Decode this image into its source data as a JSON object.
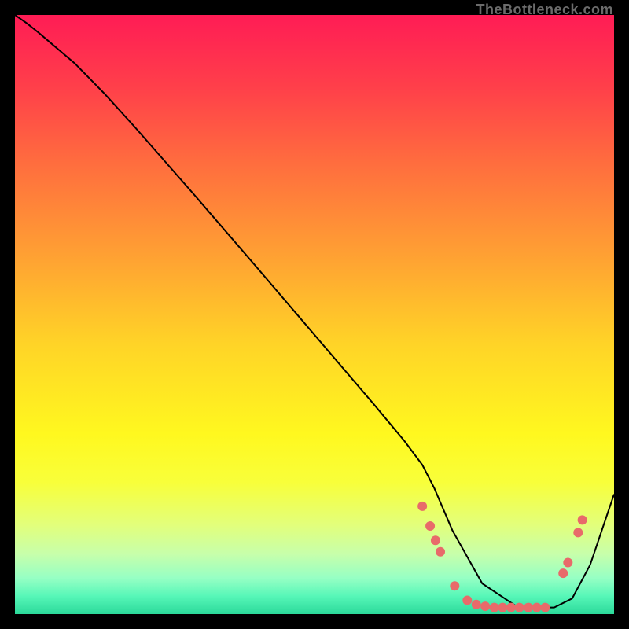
{
  "watermark": "TheBottleneck.com",
  "chart_data": {
    "type": "line",
    "title": "",
    "xlabel": "",
    "ylabel": "",
    "xlim": [
      0,
      100
    ],
    "ylim": [
      0,
      100
    ],
    "background_gradient": {
      "stops": [
        {
          "pct": 0,
          "color": "#ff1c55"
        },
        {
          "pct": 12,
          "color": "#ff3f4a"
        },
        {
          "pct": 25,
          "color": "#ff6e3e"
        },
        {
          "pct": 40,
          "color": "#ffa033"
        },
        {
          "pct": 55,
          "color": "#ffd427"
        },
        {
          "pct": 70,
          "color": "#fff81f"
        },
        {
          "pct": 78,
          "color": "#f8ff3a"
        },
        {
          "pct": 85,
          "color": "#e3ff7a"
        },
        {
          "pct": 90,
          "color": "#c7ffab"
        },
        {
          "pct": 94,
          "color": "#96ffc4"
        },
        {
          "pct": 97,
          "color": "#57f7b8"
        },
        {
          "pct": 100,
          "color": "#2bd99a"
        }
      ]
    },
    "series": [
      {
        "name": "curve",
        "stroke": "#000000",
        "stroke_width": 2,
        "x": [
          0.0,
          2.0,
          4.0,
          6.0,
          8.0,
          10.0,
          15.0,
          20.0,
          30.0,
          40.0,
          50.0,
          60.0,
          65.0,
          68.0,
          70.0,
          73.0,
          78.0,
          84.0,
          87.0,
          90.0,
          93.0,
          96.0,
          100.0
        ],
        "y": [
          100.0,
          98.6,
          97.0,
          95.3,
          93.6,
          91.9,
          86.8,
          81.3,
          69.9,
          58.3,
          46.6,
          34.9,
          28.9,
          24.9,
          21.0,
          14.0,
          5.1,
          1.1,
          1.1,
          1.1,
          2.6,
          8.2,
          20.0
        ]
      }
    ],
    "markers": {
      "name": "dots",
      "color": "#e86a6a",
      "radius": 6,
      "points": [
        {
          "x": 68.0,
          "y": 18.0
        },
        {
          "x": 69.3,
          "y": 14.7
        },
        {
          "x": 70.2,
          "y": 12.3
        },
        {
          "x": 71.0,
          "y": 10.4
        },
        {
          "x": 73.4,
          "y": 4.7
        },
        {
          "x": 75.5,
          "y": 2.3
        },
        {
          "x": 77.0,
          "y": 1.6
        },
        {
          "x": 78.5,
          "y": 1.3
        },
        {
          "x": 80.0,
          "y": 1.1
        },
        {
          "x": 81.4,
          "y": 1.1
        },
        {
          "x": 82.8,
          "y": 1.1
        },
        {
          "x": 84.2,
          "y": 1.1
        },
        {
          "x": 85.7,
          "y": 1.1
        },
        {
          "x": 87.1,
          "y": 1.1
        },
        {
          "x": 88.5,
          "y": 1.1
        },
        {
          "x": 91.5,
          "y": 6.8
        },
        {
          "x": 92.3,
          "y": 8.6
        },
        {
          "x": 94.0,
          "y": 13.6
        },
        {
          "x": 94.7,
          "y": 15.7
        }
      ]
    }
  }
}
